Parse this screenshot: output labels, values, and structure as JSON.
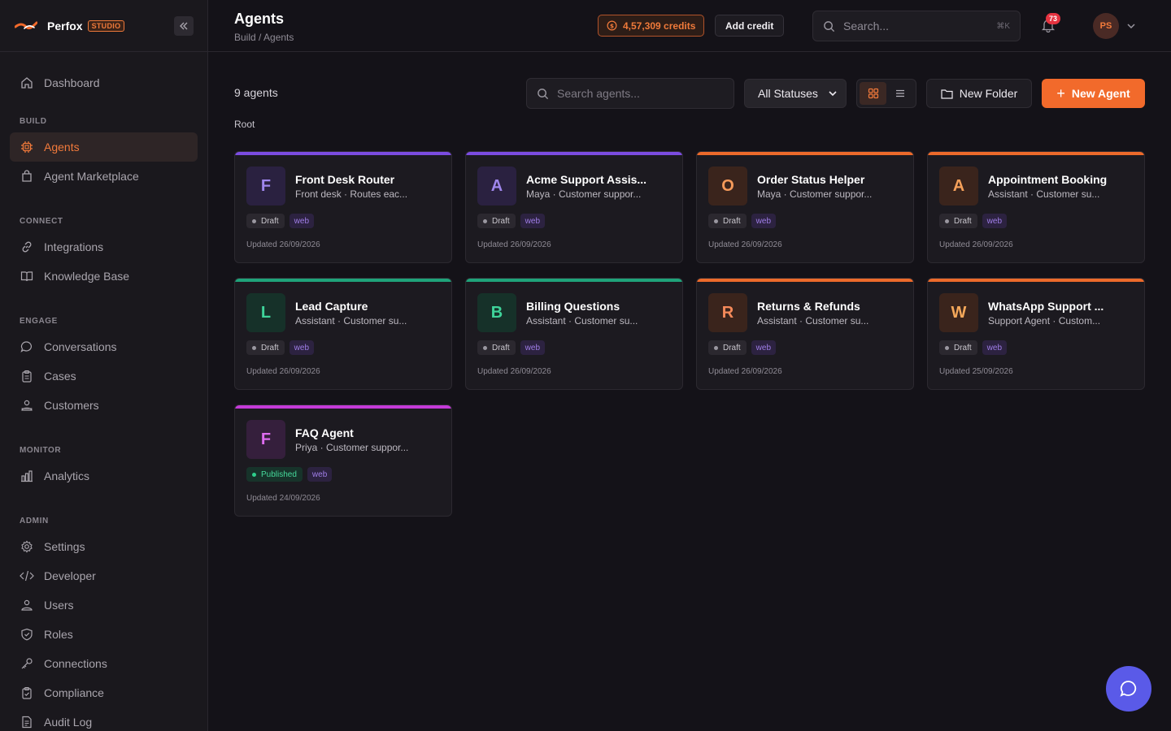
{
  "brand": {
    "name": "Perfox",
    "badge": "STUDIO"
  },
  "sidebar": {
    "items": [
      {
        "label": "Dashboard",
        "icon": "home-icon"
      },
      {
        "section": "BUILD"
      },
      {
        "label": "Agents",
        "icon": "chip-icon",
        "active": true
      },
      {
        "label": "Agent Marketplace",
        "icon": "shopping-bag-icon"
      },
      {
        "section": "CONNECT"
      },
      {
        "label": "Integrations",
        "icon": "link-icon"
      },
      {
        "label": "Knowledge Base",
        "icon": "book-icon"
      },
      {
        "section": "ENGAGE"
      },
      {
        "label": "Conversations",
        "icon": "chat-bubble-icon"
      },
      {
        "label": "Cases",
        "icon": "clipboard-icon"
      },
      {
        "label": "Customers",
        "icon": "users-icon"
      },
      {
        "section": "MONITOR"
      },
      {
        "label": "Analytics",
        "icon": "bar-chart-icon"
      },
      {
        "section": "ADMIN"
      },
      {
        "label": "Settings",
        "icon": "gear-icon"
      },
      {
        "label": "Developer",
        "icon": "code-icon"
      },
      {
        "label": "Users",
        "icon": "user-icon"
      },
      {
        "label": "Roles",
        "icon": "shield-icon"
      },
      {
        "label": "Connections",
        "icon": "key-icon"
      },
      {
        "label": "Compliance",
        "icon": "clipboard-check-icon"
      },
      {
        "label": "Audit Log",
        "icon": "document-icon"
      }
    ]
  },
  "header": {
    "title": "Agents",
    "breadcrumb": "Build / Agents",
    "credits": "4,57,309 credits",
    "add_credit": "Add credit",
    "search_placeholder": "Search...",
    "search_shortcut": "⌘K",
    "notification_count": "73",
    "avatar_initials": "PS"
  },
  "toolbar": {
    "count": "9 agents",
    "folder_path": "Root",
    "search_placeholder": "Search agents...",
    "status_filter": "All Statuses",
    "view_mode": "grid",
    "new_folder": "New Folder",
    "new_agent": "New Agent"
  },
  "agents": [
    {
      "letter": "F",
      "title": "Front Desk Router",
      "subtitle": "Front desk · Routes eac...",
      "status": "Draft",
      "channel": "web",
      "updated": "Updated 26/09/2026",
      "accent": "#7b4ce0",
      "tile_bg": "#2a2140",
      "tile_fg": "#9f86ec"
    },
    {
      "letter": "A",
      "title": "Acme Support Assis...",
      "subtitle": "Maya · Customer suppor...",
      "status": "Draft",
      "channel": "web",
      "updated": "Updated 26/09/2026",
      "accent": "#7b4ce0",
      "tile_bg": "#2a2140",
      "tile_fg": "#9f86ec"
    },
    {
      "letter": "O",
      "title": "Order Status Helper",
      "subtitle": "Maya · Customer suppor...",
      "status": "Draft",
      "channel": "web",
      "updated": "Updated 26/09/2026",
      "accent": "#ec6a2b",
      "tile_bg": "#3a241c",
      "tile_fg": "#f59a5a"
    },
    {
      "letter": "A",
      "title": "Appointment Booking",
      "subtitle": "Assistant · Customer su...",
      "status": "Draft",
      "channel": "web",
      "updated": "Updated 26/09/2026",
      "accent": "#ec6a2b",
      "tile_bg": "#3a241c",
      "tile_fg": "#f5a05a"
    },
    {
      "letter": "L",
      "title": "Lead Capture",
      "subtitle": "Assistant · Customer su...",
      "status": "Draft",
      "channel": "web",
      "updated": "Updated 26/09/2026",
      "accent": "#1fa37a",
      "tile_bg": "#163129",
      "tile_fg": "#3fd39a"
    },
    {
      "letter": "B",
      "title": "Billing Questions",
      "subtitle": "Assistant · Customer su...",
      "status": "Draft",
      "channel": "web",
      "updated": "Updated 26/09/2026",
      "accent": "#1fa37a",
      "tile_bg": "#163129",
      "tile_fg": "#3fd39a"
    },
    {
      "letter": "R",
      "title": "Returns & Refunds",
      "subtitle": "Assistant · Customer su...",
      "status": "Draft",
      "channel": "web",
      "updated": "Updated 26/09/2026",
      "accent": "#ec6a2b",
      "tile_bg": "#3a241c",
      "tile_fg": "#f58a5a"
    },
    {
      "letter": "W",
      "title": "WhatsApp Support ...",
      "subtitle": "Support Agent · Custom...",
      "status": "Draft",
      "channel": "web",
      "updated": "Updated 25/09/2026",
      "accent": "#ec6a2b",
      "tile_bg": "#3a241c",
      "tile_fg": "#f5a85a"
    },
    {
      "letter": "F",
      "title": "FAQ Agent",
      "subtitle": "Priya · Customer suppor...",
      "status": "Published",
      "channel": "web",
      "updated": "Updated 24/09/2026",
      "accent": "#c43ad8",
      "tile_bg": "#351f3c",
      "tile_fg": "#de6cf0"
    }
  ],
  "colors": {
    "accent": "#f26a2b",
    "fab": "#5a5ae8"
  }
}
